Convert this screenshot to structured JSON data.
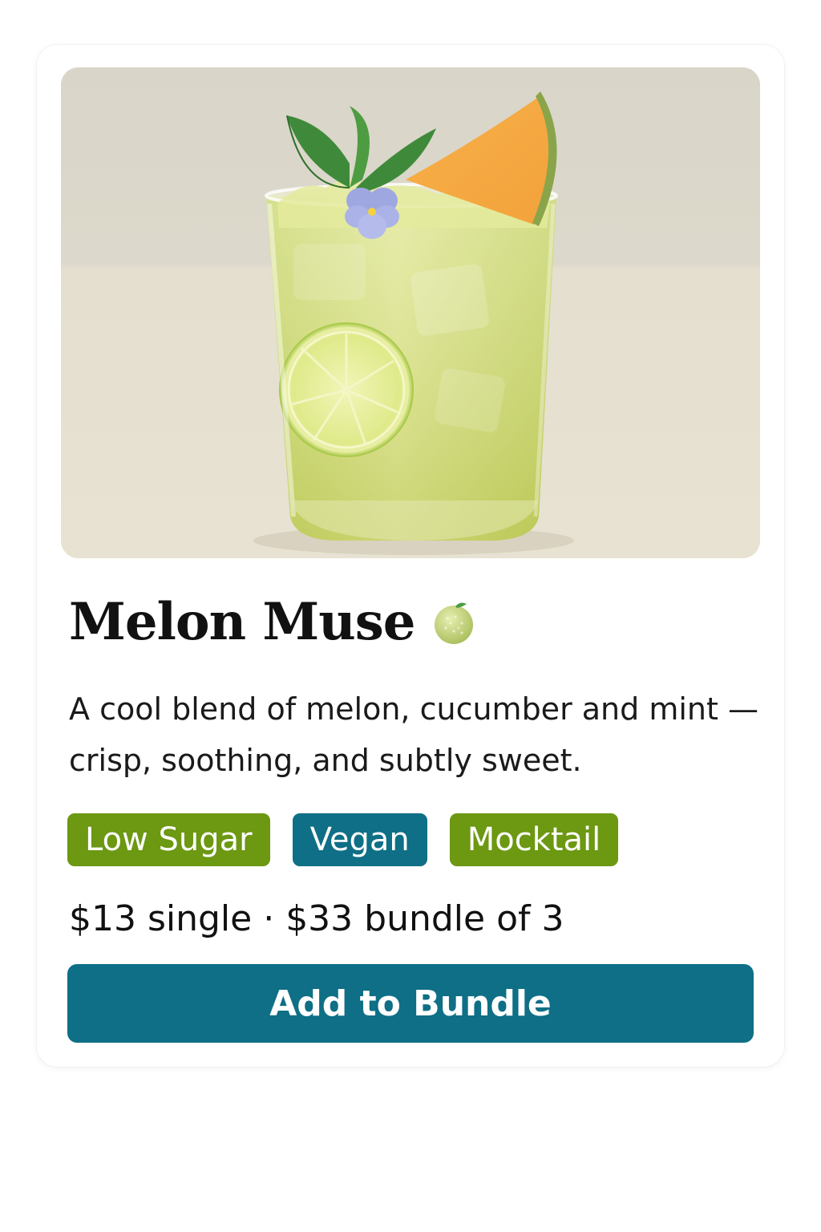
{
  "product": {
    "title": "Melon Muse",
    "title_icon": "melon-icon",
    "description": "A cool blend of melon, cucumber and mint — crisp, soothing, and subtly sweet.",
    "image": {
      "subject": "lime-green mocktail in a glass with ice, lime wheel, mint, cantaloupe wedge and a violet flower",
      "background_color": "#dcd8cc",
      "drink_color": "#cfdc6a"
    },
    "tags": [
      {
        "label": "Low Sugar",
        "color": "#6c9812"
      },
      {
        "label": "Vegan",
        "color": "#0e6f86"
      },
      {
        "label": "Mocktail",
        "color": "#6c9812"
      }
    ],
    "price_text": "$13 single · $33 bundle of 3",
    "cta": {
      "label": "Add to Bundle",
      "color": "#0e6f86"
    }
  }
}
